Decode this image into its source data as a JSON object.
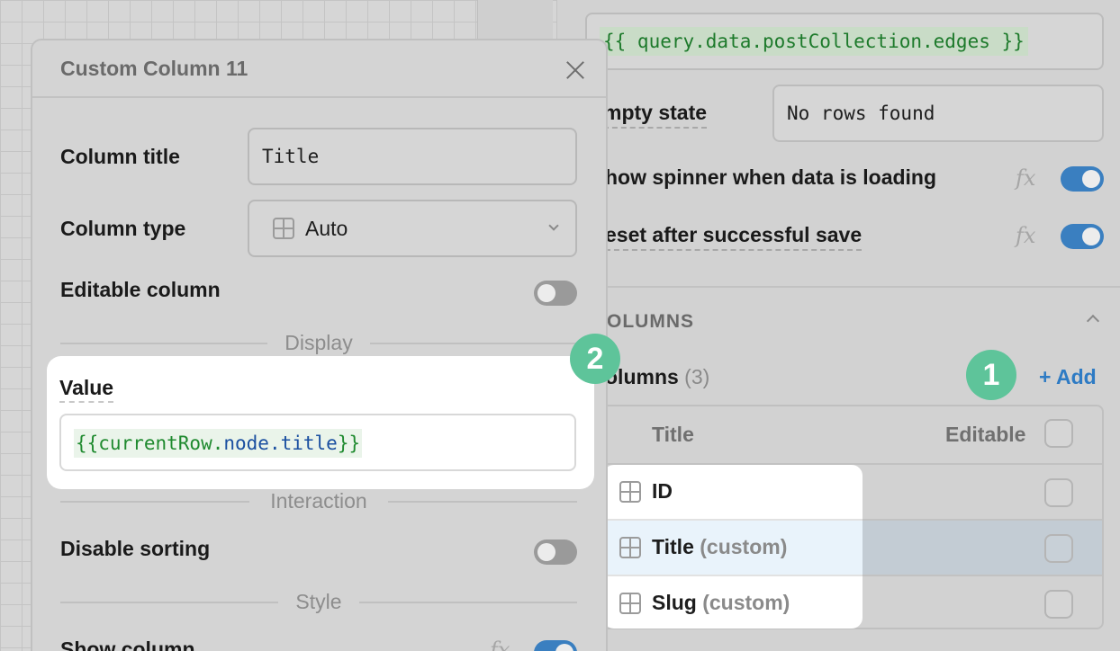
{
  "inspector": {
    "data_source_code": "{{ query.data.postCollection.edges }}",
    "empty_state_label": "mpty state",
    "empty_state_value": "No rows found",
    "show_spinner_label": "how spinner when data is loading",
    "reset_label": "eset after successful save",
    "fx_symbol": "fx",
    "show_spinner_on": true,
    "reset_on": true,
    "columns_section_label": "OLUMNS",
    "columns_count_label": "olumns",
    "columns_count": "(3)",
    "add_label": "+ Add",
    "table_header_title": "Title",
    "table_header_editable": "Editable",
    "rows": [
      {
        "name": "ID",
        "tag": ""
      },
      {
        "name": "Title",
        "tag": "(custom)"
      },
      {
        "name": "Slug",
        "tag": "(custom)"
      }
    ]
  },
  "badges": {
    "one": "1",
    "two": "2"
  },
  "modal": {
    "title": "Custom Column 11",
    "column_title_label": "Column title",
    "column_title_value": "Title",
    "column_type_label": "Column type",
    "column_type_value": "Auto",
    "editable_label": "Editable column",
    "editable_on": false,
    "display_section": "Display",
    "value_label": "Value",
    "value_open": "{{currentRow.",
    "value_prop": "node.title",
    "value_close": "}}",
    "interaction_section": "Interaction",
    "disable_sorting_label": "Disable sorting",
    "disable_sorting_on": false,
    "style_section": "Style",
    "show_column_label": "Show column",
    "show_column_on": true
  },
  "colors": {
    "accent": "#3a7fc0",
    "badge": "#5ec49a",
    "code_green": "#1d7a2b",
    "code_blue": "#1a4fa0"
  }
}
